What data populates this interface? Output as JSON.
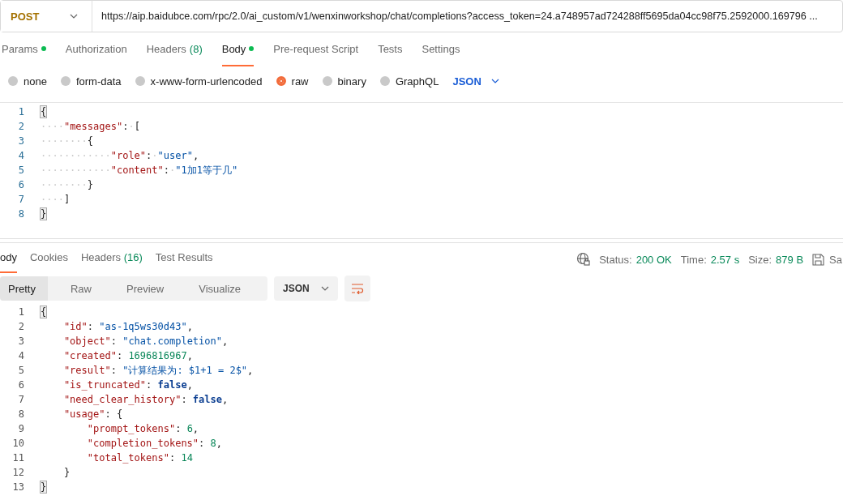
{
  "request": {
    "method": "POST",
    "url": "https://aip.baidubce.com/rpc/2.0/ai_custom/v1/wenxinworkshop/chat/completions?access_token=24.a748957ad724288ff5695da04cc98f75.2592000.169796 ..."
  },
  "request_tabs": [
    {
      "label": "Params",
      "dot": true,
      "selected": false
    },
    {
      "label": "Authorization",
      "dot": false,
      "selected": false
    },
    {
      "label": "Headers",
      "count": "(8)",
      "dot": false,
      "selected": false
    },
    {
      "label": "Body",
      "dot": true,
      "selected": true
    },
    {
      "label": "Pre-request Script",
      "dot": false,
      "selected": false
    },
    {
      "label": "Tests",
      "dot": false,
      "selected": false
    },
    {
      "label": "Settings",
      "dot": false,
      "selected": false
    }
  ],
  "body_types": [
    {
      "label": "none",
      "selected": false
    },
    {
      "label": "form-data",
      "selected": false
    },
    {
      "label": "x-www-form-urlencoded",
      "selected": false
    },
    {
      "label": "raw",
      "selected": true
    },
    {
      "label": "binary",
      "selected": false
    },
    {
      "label": "GraphQL",
      "selected": false
    }
  ],
  "body_format": "JSON",
  "request_body": [
    {
      "number": "1",
      "tokens": [
        {
          "kind": "bracket",
          "text": "{"
        }
      ]
    },
    {
      "number": "2",
      "tokens": [
        {
          "kind": "ws",
          "text": "····"
        },
        {
          "kind": "key",
          "text": "\"messages\""
        },
        {
          "kind": "punct",
          "text": ":"
        },
        {
          "kind": "ws",
          "text": "·"
        },
        {
          "kind": "punct",
          "text": "["
        }
      ]
    },
    {
      "number": "3",
      "tokens": [
        {
          "kind": "ws",
          "text": "········"
        },
        {
          "kind": "punct",
          "text": "{"
        }
      ]
    },
    {
      "number": "4",
      "tokens": [
        {
          "kind": "ws",
          "text": "············"
        },
        {
          "kind": "key",
          "text": "\"role\""
        },
        {
          "kind": "punct",
          "text": ":"
        },
        {
          "kind": "ws",
          "text": "·"
        },
        {
          "kind": "string",
          "text": "\"user\""
        },
        {
          "kind": "punct",
          "text": ","
        }
      ]
    },
    {
      "number": "5",
      "tokens": [
        {
          "kind": "ws",
          "text": "············"
        },
        {
          "kind": "key",
          "text": "\"content\""
        },
        {
          "kind": "punct",
          "text": ":"
        },
        {
          "kind": "ws",
          "text": "·"
        },
        {
          "kind": "string",
          "text": "\"1加1等于几\""
        }
      ]
    },
    {
      "number": "6",
      "tokens": [
        {
          "kind": "ws",
          "text": "········"
        },
        {
          "kind": "punct",
          "text": "}"
        }
      ]
    },
    {
      "number": "7",
      "tokens": [
        {
          "kind": "ws",
          "text": "····"
        },
        {
          "kind": "punct",
          "text": "]"
        }
      ]
    },
    {
      "number": "8",
      "tokens": [
        {
          "kind": "bracket",
          "text": "}"
        }
      ]
    }
  ],
  "response_tabs": [
    {
      "label": "ody",
      "selected": true
    },
    {
      "label": "Cookies",
      "selected": false
    },
    {
      "label": "Headers",
      "count": "(16)",
      "selected": false
    },
    {
      "label": "Test Results",
      "selected": false
    }
  ],
  "response_meta": {
    "status_label": "Status:",
    "status": "200 OK",
    "time_label": "Time:",
    "time": "2.57 s",
    "size_label": "Size:",
    "size": "879 B",
    "save": "Sa"
  },
  "view_modes": [
    {
      "label": "Pretty",
      "selected": true
    },
    {
      "label": "Raw",
      "selected": false
    },
    {
      "label": "Preview",
      "selected": false
    },
    {
      "label": "Visualize",
      "selected": false
    }
  ],
  "response_format": "JSON",
  "response_body": [
    {
      "number": "1",
      "tokens": [
        {
          "kind": "bracket",
          "text": "{"
        }
      ]
    },
    {
      "number": "2",
      "tokens": [
        {
          "kind": "key",
          "text": "    \"id\""
        },
        {
          "kind": "punct",
          "text": ": "
        },
        {
          "kind": "string",
          "text": "\"as-1q5ws30d43\""
        },
        {
          "kind": "punct",
          "text": ","
        }
      ]
    },
    {
      "number": "3",
      "tokens": [
        {
          "kind": "key",
          "text": "    \"object\""
        },
        {
          "kind": "punct",
          "text": ": "
        },
        {
          "kind": "string",
          "text": "\"chat.completion\""
        },
        {
          "kind": "punct",
          "text": ","
        }
      ]
    },
    {
      "number": "4",
      "tokens": [
        {
          "kind": "key",
          "text": "    \"created\""
        },
        {
          "kind": "punct",
          "text": ": "
        },
        {
          "kind": "number",
          "text": "1696816967"
        },
        {
          "kind": "punct",
          "text": ","
        }
      ]
    },
    {
      "number": "5",
      "tokens": [
        {
          "kind": "key",
          "text": "    \"result\""
        },
        {
          "kind": "punct",
          "text": ": "
        },
        {
          "kind": "string",
          "text": "\"计算结果为: $1+1 = 2$\""
        },
        {
          "kind": "punct",
          "text": ","
        }
      ]
    },
    {
      "number": "6",
      "tokens": [
        {
          "kind": "key",
          "text": "    \"is_truncated\""
        },
        {
          "kind": "punct",
          "text": ": "
        },
        {
          "kind": "boolean",
          "text": "false"
        },
        {
          "kind": "punct",
          "text": ","
        }
      ]
    },
    {
      "number": "7",
      "tokens": [
        {
          "kind": "key",
          "text": "    \"need_clear_history\""
        },
        {
          "kind": "punct",
          "text": ": "
        },
        {
          "kind": "boolean",
          "text": "false"
        },
        {
          "kind": "punct",
          "text": ","
        }
      ]
    },
    {
      "number": "8",
      "tokens": [
        {
          "kind": "key",
          "text": "    \"usage\""
        },
        {
          "kind": "punct",
          "text": ": {"
        }
      ]
    },
    {
      "number": "9",
      "tokens": [
        {
          "kind": "key",
          "text": "        \"prompt_tokens\""
        },
        {
          "kind": "punct",
          "text": ": "
        },
        {
          "kind": "number",
          "text": "6"
        },
        {
          "kind": "punct",
          "text": ","
        }
      ]
    },
    {
      "number": "10",
      "tokens": [
        {
          "kind": "key",
          "text": "        \"completion_tokens\""
        },
        {
          "kind": "punct",
          "text": ": "
        },
        {
          "kind": "number",
          "text": "8"
        },
        {
          "kind": "punct",
          "text": ","
        }
      ]
    },
    {
      "number": "11",
      "tokens": [
        {
          "kind": "key",
          "text": "        \"total_tokens\""
        },
        {
          "kind": "punct",
          "text": ": "
        },
        {
          "kind": "number",
          "text": "14"
        }
      ]
    },
    {
      "number": "12",
      "tokens": [
        {
          "kind": "punct",
          "text": "    }"
        }
      ]
    },
    {
      "number": "13",
      "tokens": [
        {
          "kind": "bracket",
          "text": "}"
        }
      ]
    }
  ]
}
